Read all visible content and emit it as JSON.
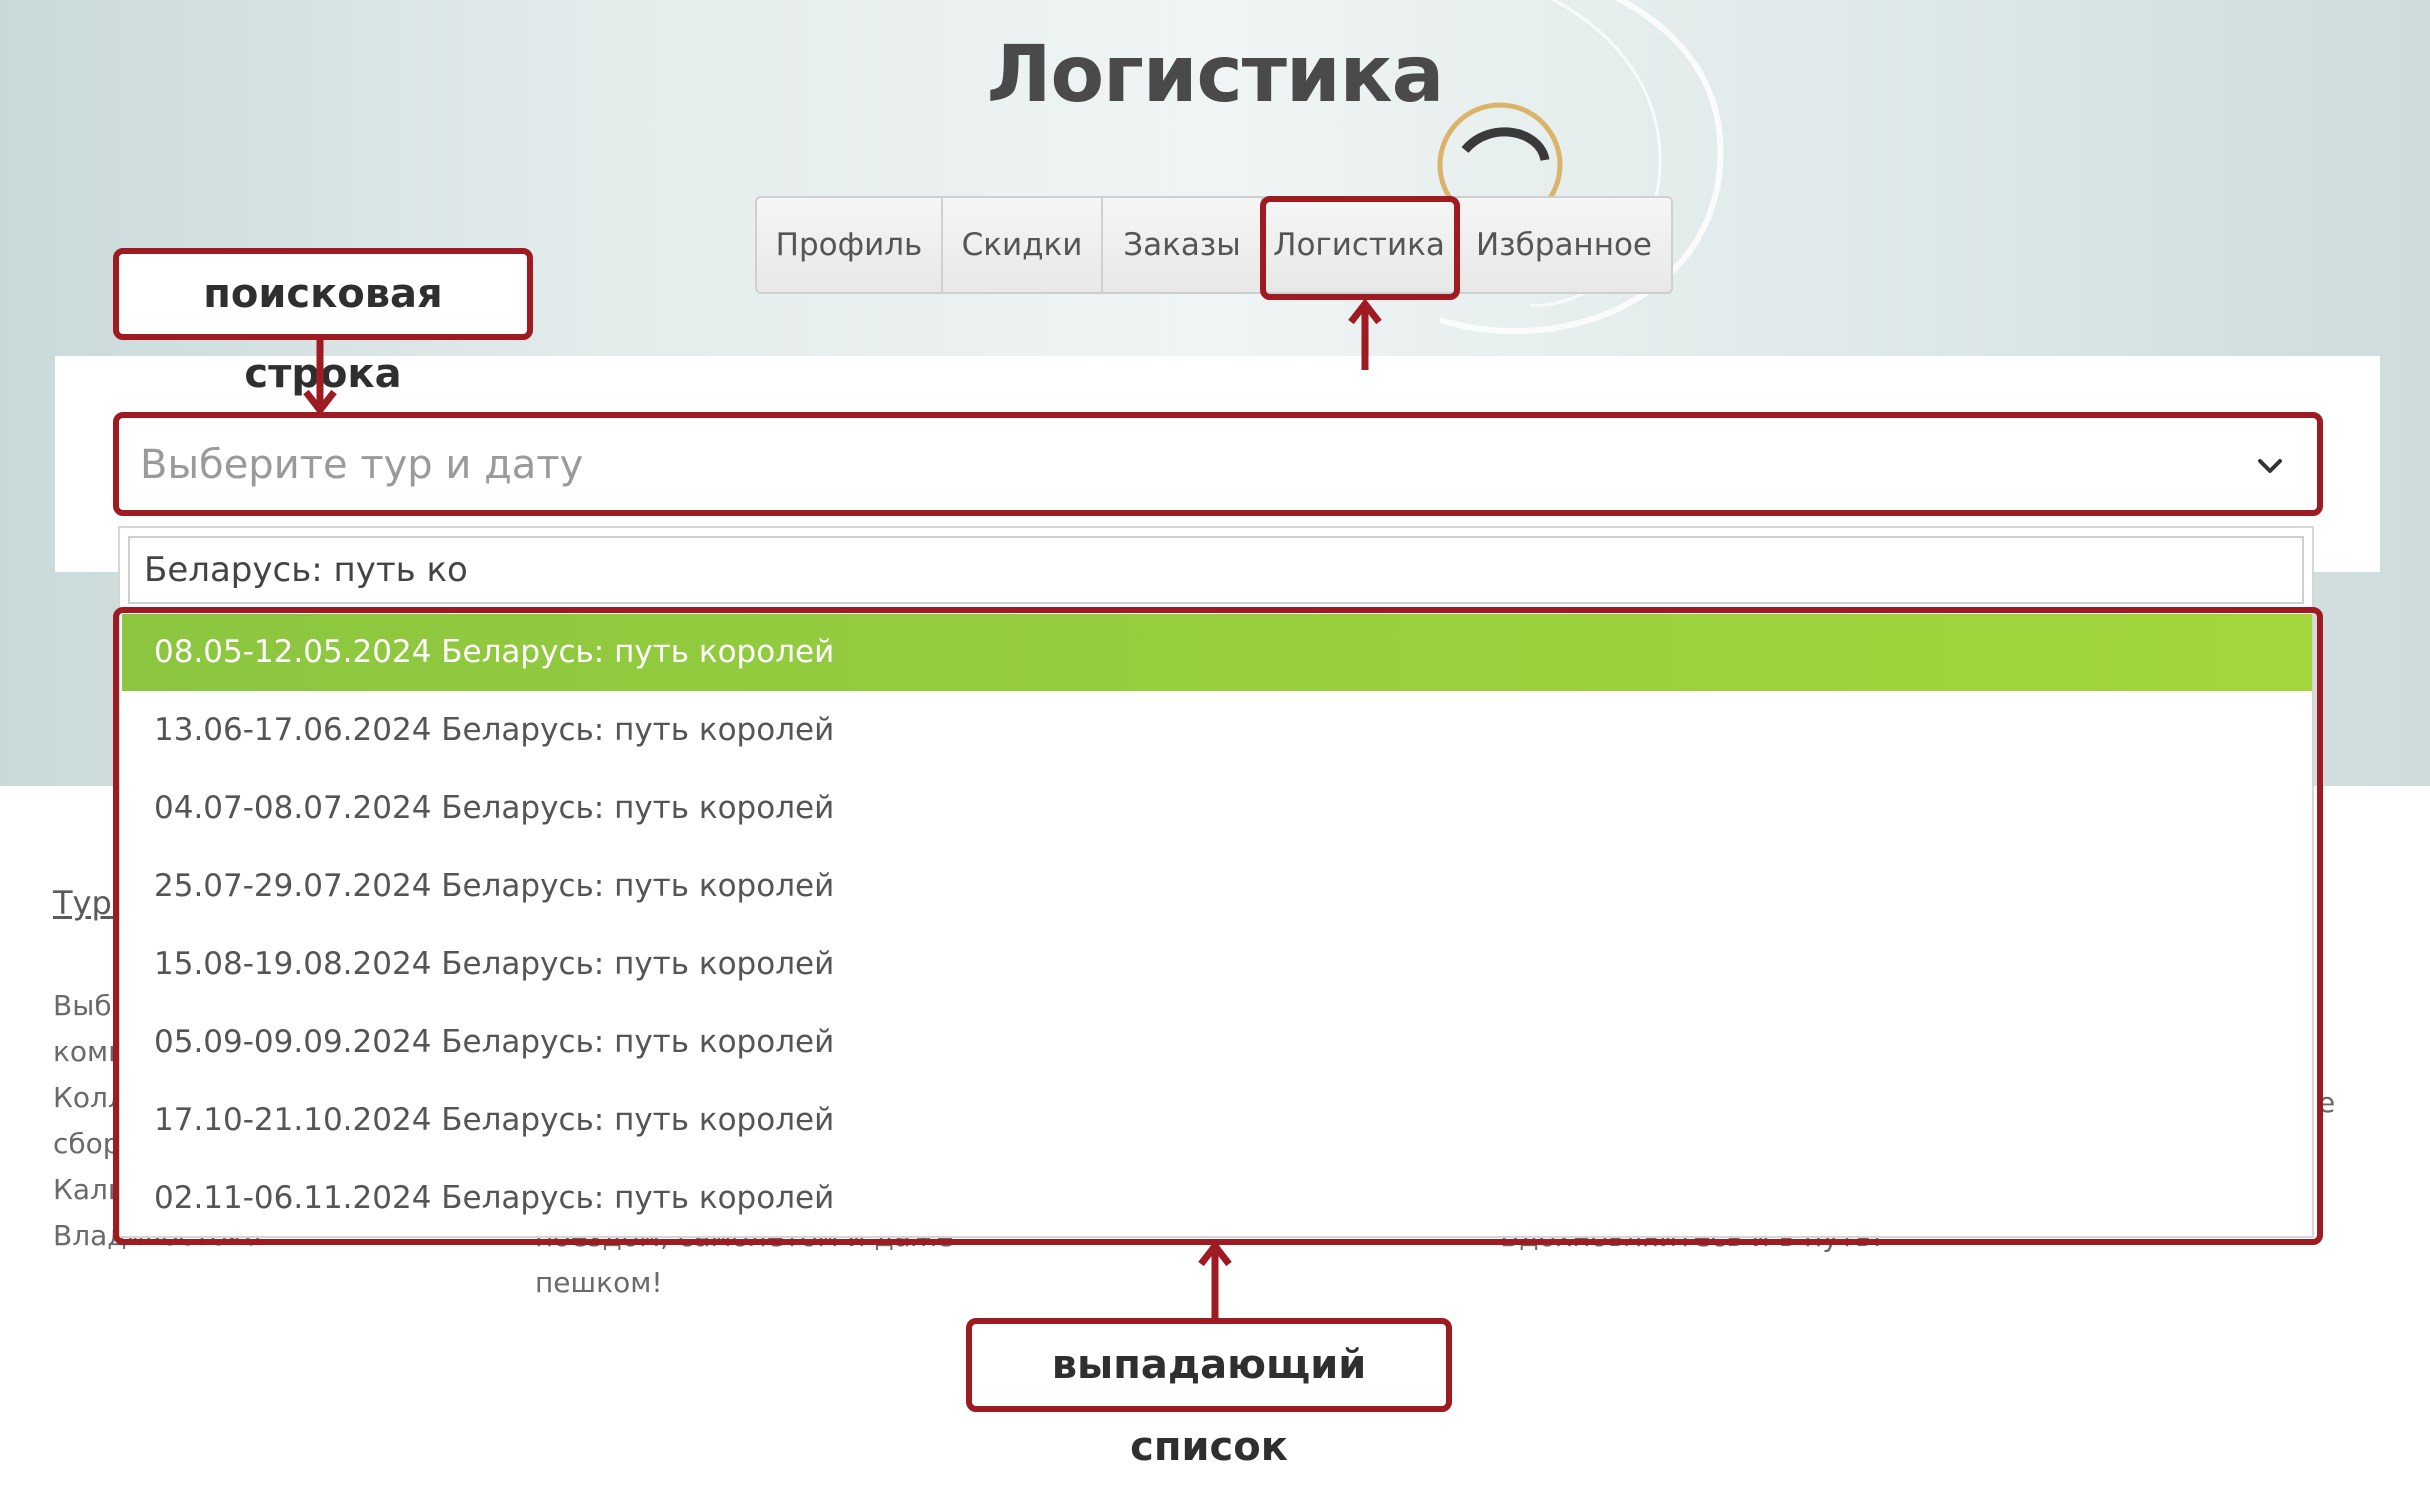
{
  "page": {
    "title": "Логистика"
  },
  "tabs": [
    {
      "label": "Профиль"
    },
    {
      "label": "Скидки"
    },
    {
      "label": "Заказы"
    },
    {
      "label": "Логистика"
    },
    {
      "label": "Избранное"
    }
  ],
  "tour_select": {
    "placeholder": "Выберите тур и дату",
    "search_value": "Беларусь: путь ко",
    "options": [
      {
        "label": "08.05-12.05.2024 Беларусь: путь королей",
        "highlighted": true
      },
      {
        "label": "13.06-17.06.2024 Беларусь: путь королей"
      },
      {
        "label": "04.07-08.07.2024 Беларусь: путь королей"
      },
      {
        "label": "25.07-29.07.2024 Беларусь: путь королей"
      },
      {
        "label": "15.08-19.08.2024 Беларусь: путь королей"
      },
      {
        "label": "05.09-09.09.2024 Беларусь: путь королей"
      },
      {
        "label": "17.10-21.10.2024 Беларусь: путь королей"
      },
      {
        "label": "02.11-06.11.2024 Беларусь: путь королей"
      }
    ]
  },
  "background_text": {
    "col1_link": "Туры",
    "col1_lines": [
      "Выб",
      "комп",
      "Колл",
      "сбор",
      "Кали",
      "Владивостока."
    ],
    "col2_lines": [
      "поездом, самолетом и даже",
      "пешком!"
    ],
    "col3_line": "Вдохновляйтесь и в путь!",
    "col3_stub": "е"
  },
  "annotations": {
    "search_label": "поисковая строка",
    "dropdown_label": "выпадающий список"
  },
  "colors": {
    "annotation": "#9e1b22",
    "highlight": "#8cc63f",
    "title": "#4a4a4a"
  }
}
